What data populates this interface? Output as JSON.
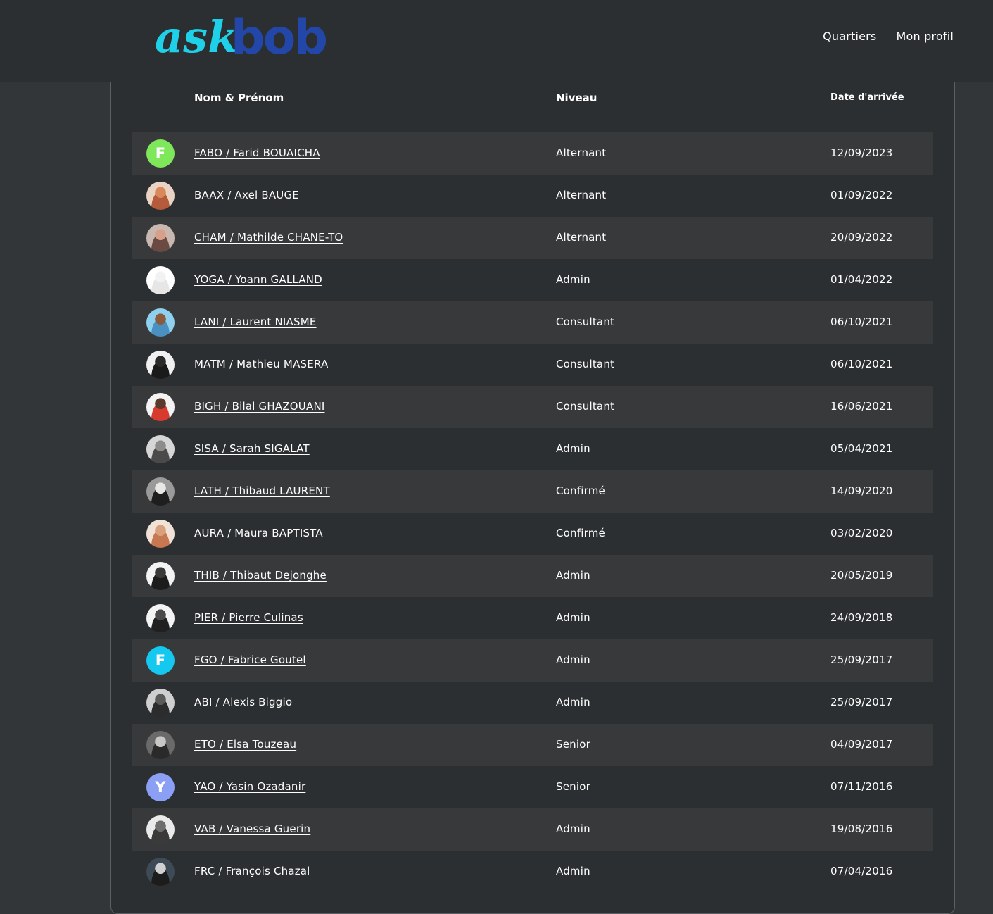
{
  "header": {
    "logo": {
      "ask_text": "ask",
      "bob_text": "bob",
      "ask_color": "#1fd1e8",
      "bob_color": "#2247a8"
    },
    "nav": [
      {
        "label": "Quartiers"
      },
      {
        "label": "Mon profil"
      }
    ]
  },
  "table": {
    "columns": {
      "name": "Nom & Prénom",
      "level": "Niveau",
      "date": "Date d'arrivée"
    },
    "rows": [
      {
        "avatar": {
          "type": "initial",
          "letter": "F",
          "color": "#7fe85a"
        },
        "name": "FABO / Farid BOUAICHA",
        "level": "Alternant",
        "date": "12/09/2023"
      },
      {
        "avatar": {
          "type": "photo",
          "bg": "#e9d3c2",
          "face": "#d9885a",
          "body": "#b55a3a"
        },
        "name": "BAAX / Axel BAUGE",
        "level": "Alternant",
        "date": "01/09/2022"
      },
      {
        "avatar": {
          "type": "photo",
          "bg": "#c9b8b0",
          "face": "#d8a08a",
          "body": "#6b4a44"
        },
        "name": "CHAM / Mathilde CHANE-TO",
        "level": "Alternant",
        "date": "20/09/2022"
      },
      {
        "avatar": {
          "type": "photo",
          "bg": "#ffffff",
          "face": "#f2f2f2",
          "body": "#e6e6e6"
        },
        "name": "YOGA / Yoann GALLAND",
        "level": "Admin",
        "date": "01/04/2022"
      },
      {
        "avatar": {
          "type": "photo",
          "bg": "#8fd0ef",
          "face": "#8a5a3c",
          "body": "#4a90c0"
        },
        "name": "LANI / Laurent NIASME",
        "level": "Consultant",
        "date": "06/10/2021"
      },
      {
        "avatar": {
          "type": "photo",
          "bg": "#f0f0f0",
          "face": "#2a2a2a",
          "body": "#1a1a1a"
        },
        "name": "MATM / Mathieu MASERA",
        "level": "Consultant",
        "date": "06/10/2021"
      },
      {
        "avatar": {
          "type": "photo",
          "bg": "#f4f4f4",
          "face": "#5a3a2c",
          "body": "#d93a2e"
        },
        "name": "BIGH / Bilal GHAZOUANI",
        "level": "Consultant",
        "date": "16/06/2021"
      },
      {
        "avatar": {
          "type": "photo",
          "bg": "#d6d6d6",
          "face": "#8c8c8c",
          "body": "#4a4a4a"
        },
        "name": "SISA / Sarah SIGALAT",
        "level": "Admin",
        "date": "05/04/2021"
      },
      {
        "avatar": {
          "type": "photo",
          "bg": "#9a9a9a",
          "face": "#e8e8e8",
          "body": "#1e1e1e"
        },
        "name": "LATH / Thibaud LAURENT",
        "level": "Confirmé",
        "date": "14/09/2020"
      },
      {
        "avatar": {
          "type": "photo",
          "bg": "#f0e2d6",
          "face": "#d8a07c",
          "body": "#c87850"
        },
        "name": "AURA / Maura BAPTISTA",
        "level": "Confirmé",
        "date": "03/02/2020"
      },
      {
        "avatar": {
          "type": "photo",
          "bg": "#f4f4f4",
          "face": "#3a3a3a",
          "body": "#1c1c1c"
        },
        "name": "THIB / Thibaut Dejonghe",
        "level": "Admin",
        "date": "20/05/2019"
      },
      {
        "avatar": {
          "type": "photo",
          "bg": "#f4f4f4",
          "face": "#4a4a4a",
          "body": "#202020"
        },
        "name": "PIER / Pierre Culinas",
        "level": "Admin",
        "date": "24/09/2018"
      },
      {
        "avatar": {
          "type": "initial",
          "letter": "F",
          "color": "#14c8f0"
        },
        "name": "FGO / Fabrice Goutel",
        "level": "Admin",
        "date": "25/09/2017"
      },
      {
        "avatar": {
          "type": "photo",
          "bg": "#cfcfcf",
          "face": "#5a5a5a",
          "body": "#2c2c2c"
        },
        "name": "ABI / Alexis Biggio",
        "level": "Admin",
        "date": "25/09/2017"
      },
      {
        "avatar": {
          "type": "photo",
          "bg": "#6a6a6a",
          "face": "#c8c8c8",
          "body": "#2a2a2a"
        },
        "name": "ETO / Elsa Touzeau",
        "level": "Senior",
        "date": "04/09/2017"
      },
      {
        "avatar": {
          "type": "initial",
          "letter": "Y",
          "color": "#8b9ff5"
        },
        "name": "YAO / Yasin Ozadanir",
        "level": "Senior",
        "date": "07/11/2016"
      },
      {
        "avatar": {
          "type": "photo",
          "bg": "#eaeaea",
          "face": "#6e6e6e",
          "body": "#3a3a3a"
        },
        "name": "VAB / Vanessa Guerin",
        "level": "Admin",
        "date": "19/08/2016"
      },
      {
        "avatar": {
          "type": "photo",
          "bg": "#3e4a55",
          "face": "#d0d0d0",
          "body": "#1c1c1c"
        },
        "name": "FRC / François Chazal",
        "level": "Admin",
        "date": "07/04/2016"
      }
    ]
  }
}
